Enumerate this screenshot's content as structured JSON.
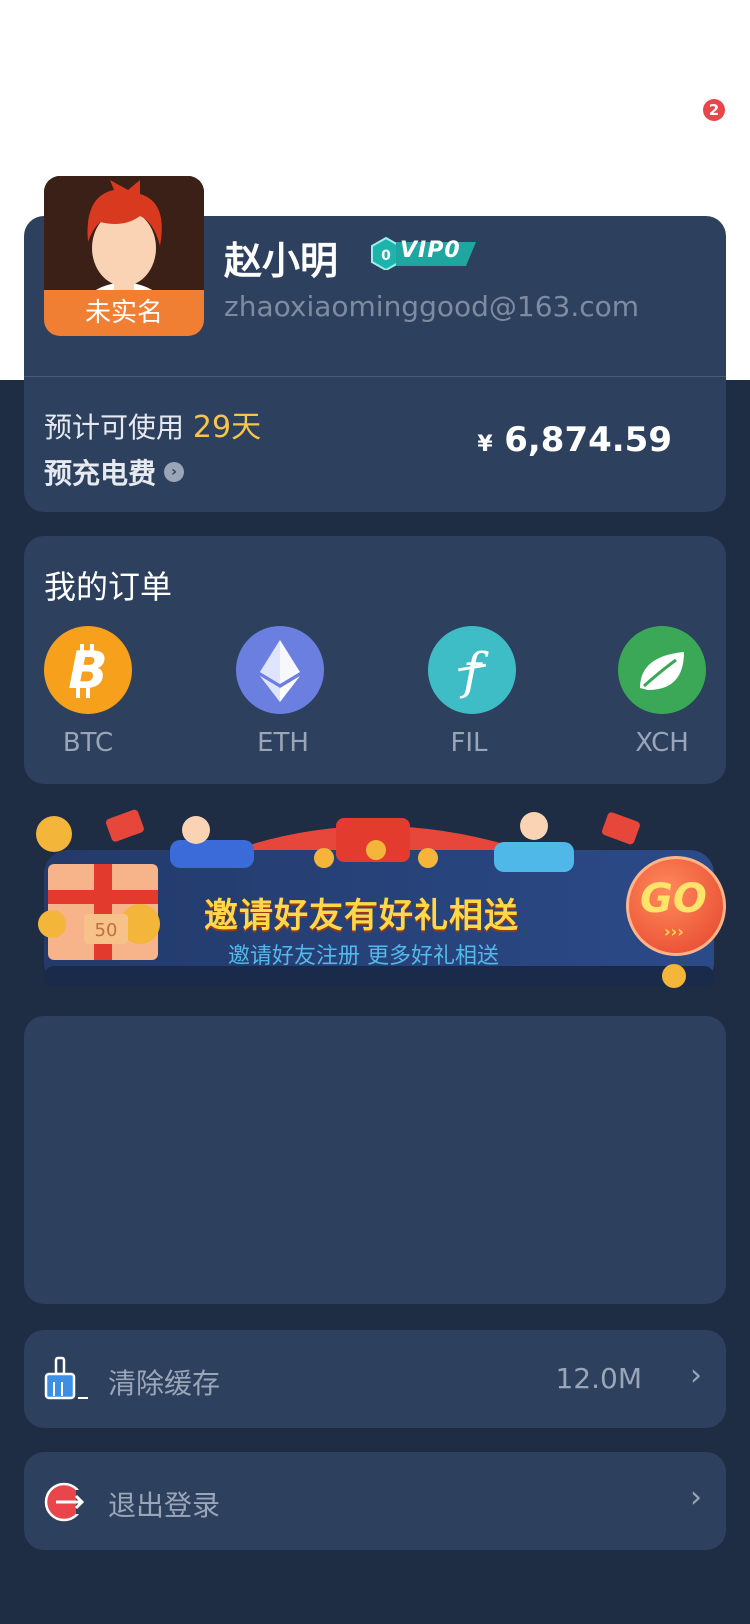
{
  "notification": {
    "count": "2"
  },
  "profile": {
    "avatar_label": "未实名",
    "name": "赵小明",
    "vip_level": "0",
    "vip_label": "VIP0",
    "email": "zhaoxiaominggood@163.com",
    "days_prefix": "预计可使用",
    "days_value": "29天",
    "recharge_label": "预充电费",
    "balance_currency": "¥",
    "balance_amount": "6,874.59"
  },
  "orders": {
    "title": "我的订单",
    "coins": [
      {
        "label": "BTC",
        "color": "#f7a01b",
        "icon": "bitcoin-icon"
      },
      {
        "label": "ETH",
        "color": "#6a7fe0",
        "icon": "ethereum-icon"
      },
      {
        "label": "FIL",
        "color": "#3fbdc6",
        "icon": "filecoin-icon"
      },
      {
        "label": "XCH",
        "color": "#3aa856",
        "icon": "chia-leaf-icon"
      }
    ]
  },
  "banner": {
    "title": "邀请好友有好礼相送",
    "subtitle": "邀请好友注册 更多好礼相送",
    "go_label": "GO",
    "coupon_value": "50"
  },
  "settings": {
    "clear_cache_label": "清除缓存",
    "clear_cache_value": "12.0M",
    "logout_label": "退出登录"
  },
  "colors": {
    "background": "#1f2d44",
    "card": "#2d405e",
    "accent_yellow": "#f6c64a",
    "vip_teal": "#1fa6a0",
    "danger_red": "#e8464a"
  }
}
